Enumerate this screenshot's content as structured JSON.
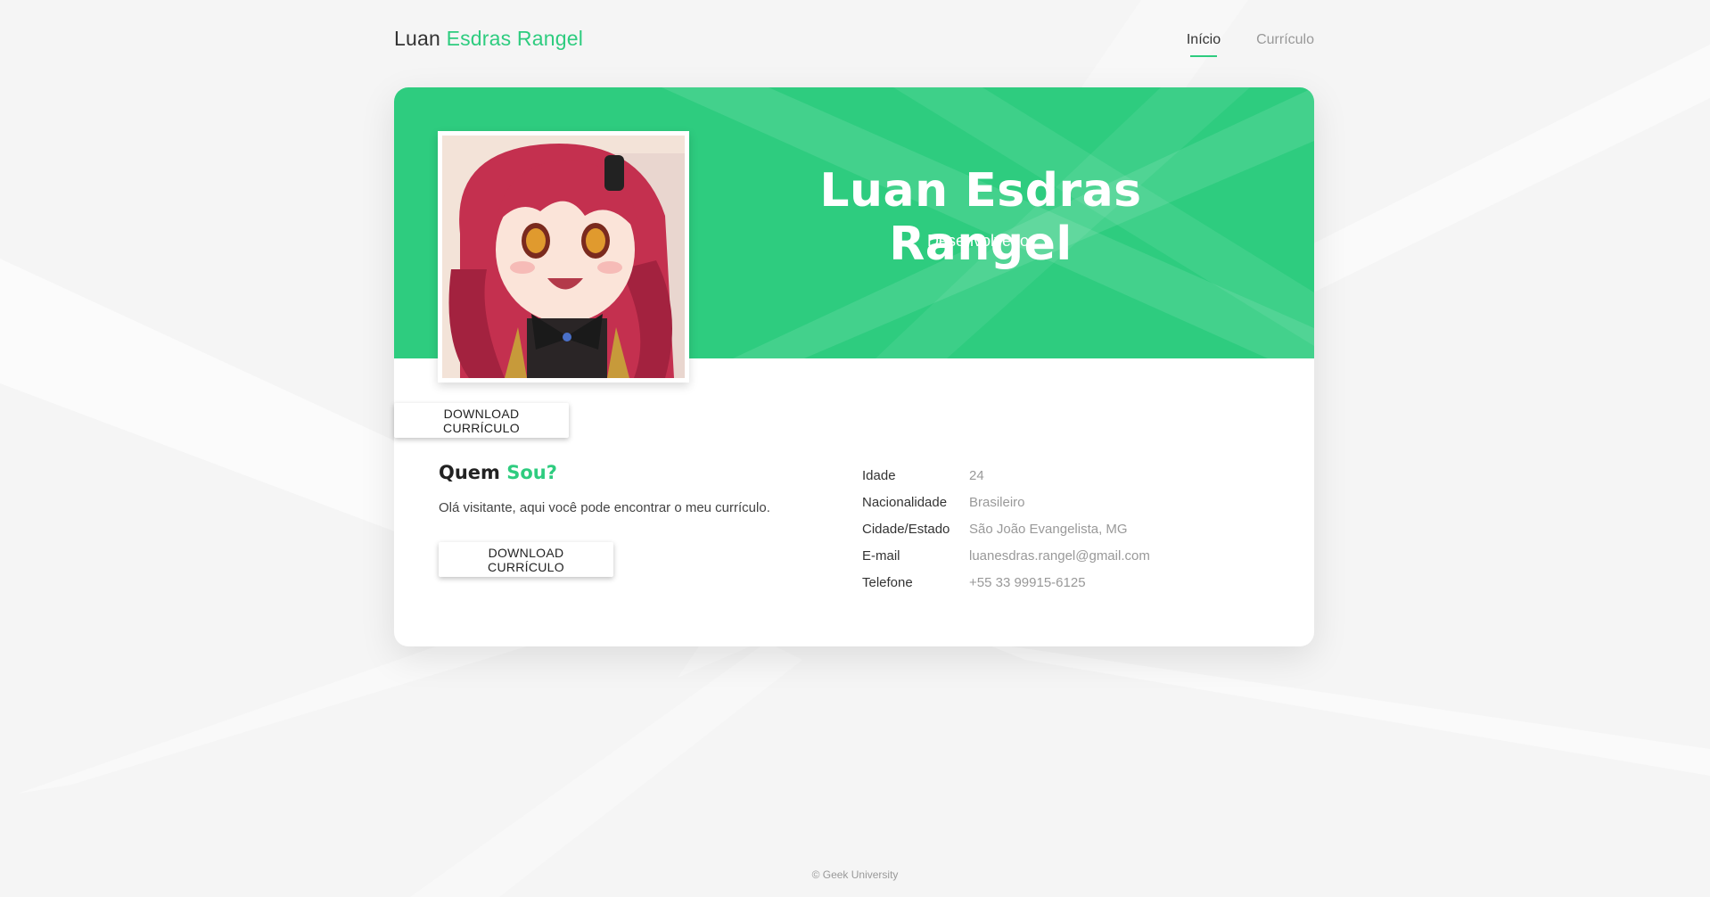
{
  "header": {
    "brand_first": "Luan",
    "brand_accent": "Esdras Rangel",
    "nav": [
      {
        "label": "Início",
        "active": true
      },
      {
        "label": "Currículo",
        "active": false
      }
    ]
  },
  "hero": {
    "name": "Luan Esdras Rangel",
    "role": "Desenvolvedor"
  },
  "download_button_label": "DOWNLOAD CURRÍCULO",
  "about": {
    "title_first": "Quem",
    "title_accent": "Sou?",
    "text": "Olá visitante, aqui você pode encontrar o meu currículo.",
    "button_label": "DOWNLOAD CURRÍCULO"
  },
  "info": [
    {
      "key": "Idade",
      "value": "24"
    },
    {
      "key": "Nacionalidade",
      "value": "Brasileiro"
    },
    {
      "key": "Cidade/Estado",
      "value": "São João Evangelista, MG"
    },
    {
      "key": "E-mail",
      "value": "luanesdras.rangel@gmail.com"
    },
    {
      "key": "Telefone",
      "value": "+55 33 99915-6125"
    }
  ],
  "footer": {
    "text": "© Geek University"
  },
  "colors": {
    "accent": "#2ecc7f",
    "background": "#f5f5f5",
    "card": "#ffffff"
  },
  "icons": {
    "profile_photo": "anime-avatar-image"
  }
}
